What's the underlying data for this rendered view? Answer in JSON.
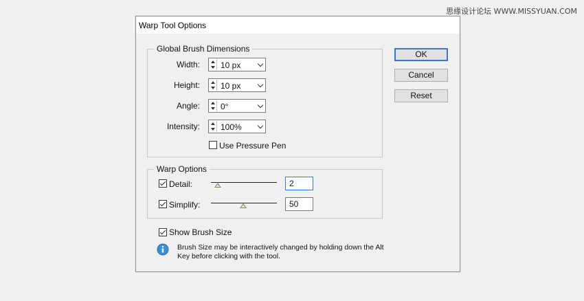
{
  "watermark": "思缘设计论坛  WWW.MISSYUAN.COM",
  "dialog": {
    "title": "Warp Tool Options",
    "global": {
      "legend": "Global Brush Dimensions",
      "width_label": "Width:",
      "width_value": "10 px",
      "height_label": "Height:",
      "height_value": "10 px",
      "angle_label": "Angle:",
      "angle_value": "0°",
      "intensity_label": "Intensity:",
      "intensity_value": "100%",
      "pressure_label": "Use Pressure Pen",
      "pressure_checked": false
    },
    "warp": {
      "legend": "Warp Options",
      "detail_label": "Detail:",
      "detail_value": "2",
      "detail_checked": true,
      "simplify_label": "Simplify:",
      "simplify_value": "50",
      "simplify_checked": true
    },
    "show_brush_label": "Show Brush Size",
    "show_brush_checked": true,
    "info_text": "Brush Size may be interactively changed by holding down the Alt Key before clicking with the tool.",
    "buttons": {
      "ok": "OK",
      "cancel": "Cancel",
      "reset": "Reset"
    },
    "colors": {
      "focus": "#2e7bd6",
      "info_icon": "#3a8fd6"
    }
  }
}
